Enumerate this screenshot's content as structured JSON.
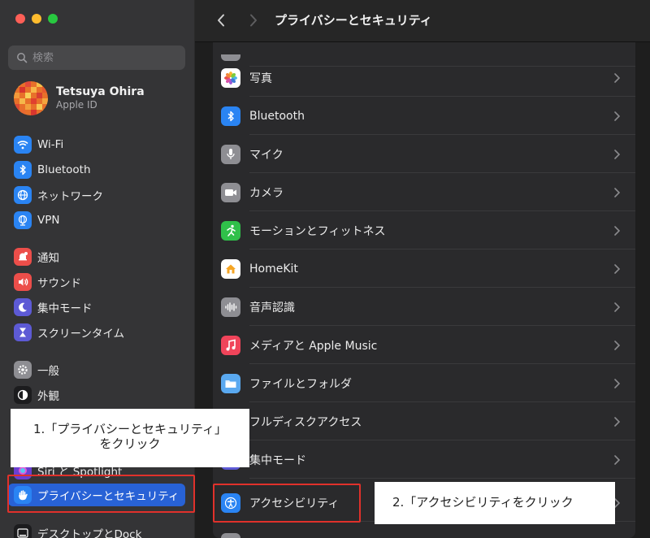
{
  "window": {
    "title": "プライバシーとセキュリティ"
  },
  "search": {
    "placeholder": "検索"
  },
  "profile": {
    "name": "Tetsuya Ohira",
    "subtitle": "Apple ID"
  },
  "sidebar": {
    "items": [
      {
        "label": "Wi-Fi",
        "icon": "wifi-icon",
        "color": "#2a84f3"
      },
      {
        "label": "Bluetooth",
        "icon": "bluetooth-icon",
        "color": "#2a84f3"
      },
      {
        "label": "ネットワーク",
        "icon": "globe-icon",
        "color": "#2a84f3"
      },
      {
        "label": "VPN",
        "icon": "vpn-globe-icon",
        "color": "#2a84f3"
      },
      {
        "label": "通知",
        "icon": "bell-icon",
        "color": "#ec4e4a"
      },
      {
        "label": "サウンド",
        "icon": "speaker-icon",
        "color": "#ec4e4a"
      },
      {
        "label": "集中モード",
        "icon": "moon-icon",
        "color": "#5d5ad5"
      },
      {
        "label": "スクリーンタイム",
        "icon": "hourglass-icon",
        "color": "#5d5ad5"
      },
      {
        "label": "一般",
        "icon": "gear-icon",
        "color": "#8e8e93"
      },
      {
        "label": "外観",
        "icon": "appearance-icon",
        "color": "#1c1c1e"
      },
      {
        "label": "Siri と Spotlight",
        "icon": "siri-icon",
        "color": "#6b3fd2"
      },
      {
        "label": "プライバシーとセキュリティ",
        "icon": "hand-icon",
        "color": "#2a84f3"
      },
      {
        "label": "デスクトップとDock",
        "icon": "dock-icon",
        "color": "#1c1c1e"
      }
    ]
  },
  "main": {
    "rows": [
      {
        "label": "写真",
        "icon": "photos-icon",
        "color": "#ffffff"
      },
      {
        "label": "Bluetooth",
        "icon": "bluetooth-icon",
        "color": "#2a84f3"
      },
      {
        "label": "マイク",
        "icon": "microphone-icon",
        "color": "#8e8e93"
      },
      {
        "label": "カメラ",
        "icon": "camera-icon",
        "color": "#8e8e93"
      },
      {
        "label": "モーションとフィットネス",
        "icon": "running-icon",
        "color": "#30c04a"
      },
      {
        "label": "HomeKit",
        "icon": "home-icon",
        "color": "#ffffff"
      },
      {
        "label": "音声認識",
        "icon": "waveform-icon",
        "color": "#8e8e93"
      },
      {
        "label": "メディアと Apple Music",
        "icon": "music-note-icon",
        "color": "#f0445a"
      },
      {
        "label": "ファイルとフォルダ",
        "icon": "folder-icon",
        "color": "#5aa9f0"
      },
      {
        "label": "フルディスクアクセス",
        "icon": "disk-icon",
        "color": "#8e8e93"
      },
      {
        "label": "集中モード",
        "icon": "moon-icon",
        "color": "#5d5ad5"
      },
      {
        "label": "アクセシビリティ",
        "icon": "accessibility-icon",
        "color": "#2a84f3"
      }
    ]
  },
  "annotations": {
    "note1_line1": "1.「プライバシーとセキュリティ」",
    "note1_line2": "をクリック",
    "note2": "2.「アクセシビリティをクリック"
  },
  "colors": {
    "accent": "#2862d6",
    "annotation_border": "#e0312b"
  }
}
